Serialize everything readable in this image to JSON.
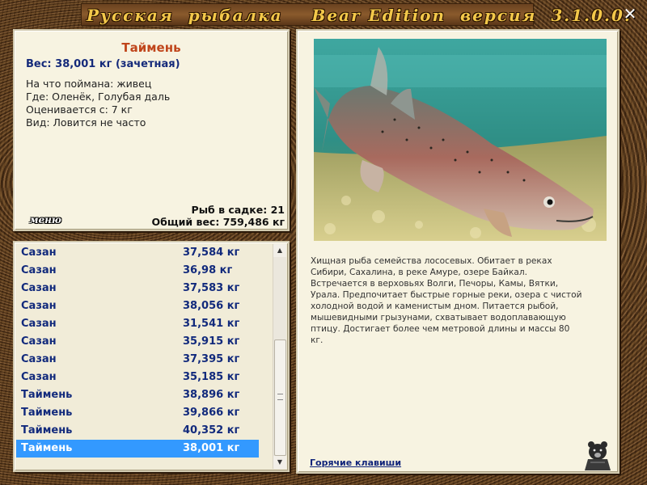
{
  "window": {
    "title": "Русская  рыбалка    Bear Edition  версия  3.1.0.0.",
    "close_icon": "close-icon"
  },
  "info": {
    "fish_name": "Таймень",
    "weight_line": "Вес: 38,001 кг (зачетная)",
    "details": [
      "На что поймана: живец",
      "Где: Оленёк, Голубая даль",
      "Оценивается с: 7 кг",
      "Вид: Ловится не часто"
    ],
    "menu_label": "меню",
    "fish_in_net": "Рыб в садке: 21",
    "total_weight": "Общий вес: 759,486 кг"
  },
  "catch_list": {
    "rows": [
      {
        "name": "Сазан",
        "weight": "37,584 кг"
      },
      {
        "name": "Сазан",
        "weight": "36,98 кг"
      },
      {
        "name": "Сазан",
        "weight": "37,583 кг"
      },
      {
        "name": "Сазан",
        "weight": "38,056 кг"
      },
      {
        "name": "Сазан",
        "weight": "31,541 кг"
      },
      {
        "name": "Сазан",
        "weight": "35,915 кг"
      },
      {
        "name": "Сазан",
        "weight": "37,395 кг"
      },
      {
        "name": "Сазан",
        "weight": "35,185 кг"
      },
      {
        "name": "Таймень",
        "weight": "38,896 кг"
      },
      {
        "name": "Таймень",
        "weight": "39,866 кг"
      },
      {
        "name": "Таймень",
        "weight": "40,352 кг"
      },
      {
        "name": "Таймень",
        "weight": "38,001 кг"
      }
    ],
    "selected_index": 11
  },
  "description": {
    "text": "Хищная рыба семейства лососевых. Обитает в реках Сибири, Сахалина, в реке Амуре, озере Байкал. Встречается в верховьях Волги, Печоры, Камы, Вятки, Урала. Предпочитает быстрые горные реки, озера с чистой холодной водой и каменистым дном. Питается рыбой, мышевидными грызунами, схватывает водоплавающую птицу. Достигает более чем метровой длины и массы 80 кг.",
    "hotkeys_label": "Горячие клавиши",
    "bear_icon": "bear-logo-icon"
  },
  "colors": {
    "fish_name": "#c0461c",
    "list_text": "#122a7c",
    "selected_bg": "#3399ff",
    "title_text": "#f3c84a"
  }
}
